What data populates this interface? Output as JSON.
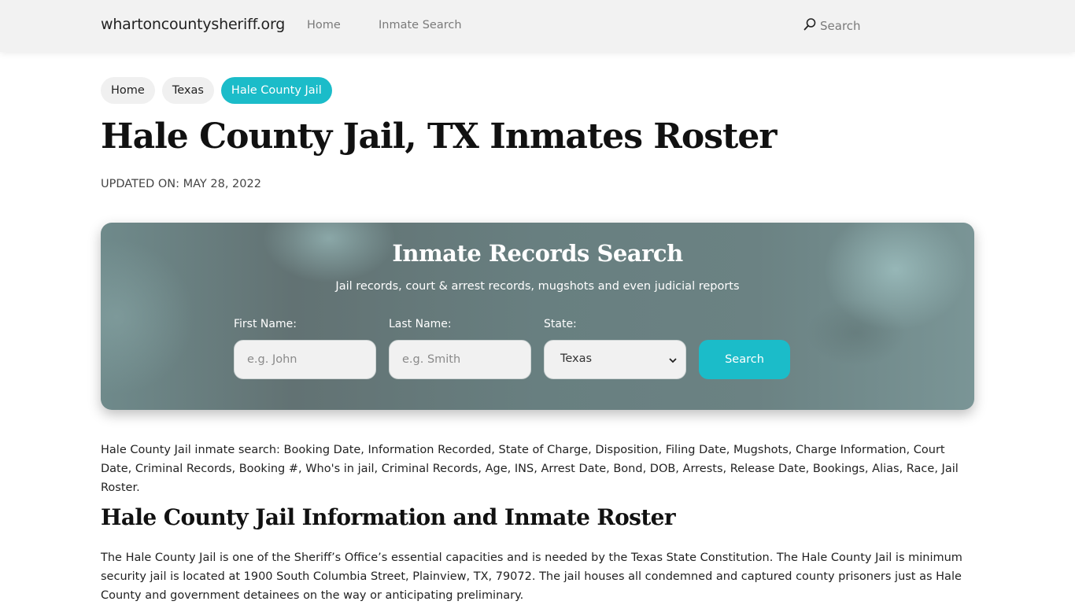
{
  "navbar": {
    "brand": "whartoncountysheriff.org",
    "links": [
      "Home",
      "Inmate Search"
    ],
    "search_label": "Search",
    "search_icon": "search-icon"
  },
  "breadcrumb": {
    "items": [
      "Home",
      "Texas",
      "Hale County Jail"
    ],
    "active_index": 2,
    "active_color": "#1bbcc9"
  },
  "page": {
    "title": "Hale County Jail, TX Inmates Roster",
    "updated": "UPDATED ON: MAY 28, 2022"
  },
  "search_panel": {
    "title": "Inmate Records Search",
    "subtitle": "Jail records, court & arrest records, mugshots and even judicial reports",
    "first_name": {
      "label": "First Name:",
      "placeholder": "e.g. John",
      "value": ""
    },
    "last_name": {
      "label": "Last Name:",
      "placeholder": "e.g. Smith",
      "value": ""
    },
    "state": {
      "label": "State:",
      "selected": "Texas"
    },
    "button_label": "Search",
    "button_color": "#1bbcc9"
  },
  "content": {
    "intro": "Hale County Jail inmate search: Booking Date, Information Recorded, State of Charge, Disposition, Filing Date, Mugshots, Charge Information, Court Date, Criminal Records, Booking #, Who's in jail, Criminal Records, Age, INS, Arrest Date, Bond, DOB, Arrests, Release Date, Bookings, Alias, Race, Jail Roster.",
    "section_heading": "Hale County Jail Information and Inmate Roster",
    "section_paragraph": "The Hale County Jail is one of the Sheriff’s Office’s essential capacities and is needed by the Texas State Constitution. The Hale County Jail is minimum security jail is located at 1900 South Columbia Street, Plainview, TX, 79072. The jail houses all condemned and captured county prisoners just as Hale County and government detainees on the way or anticipating preliminary."
  }
}
